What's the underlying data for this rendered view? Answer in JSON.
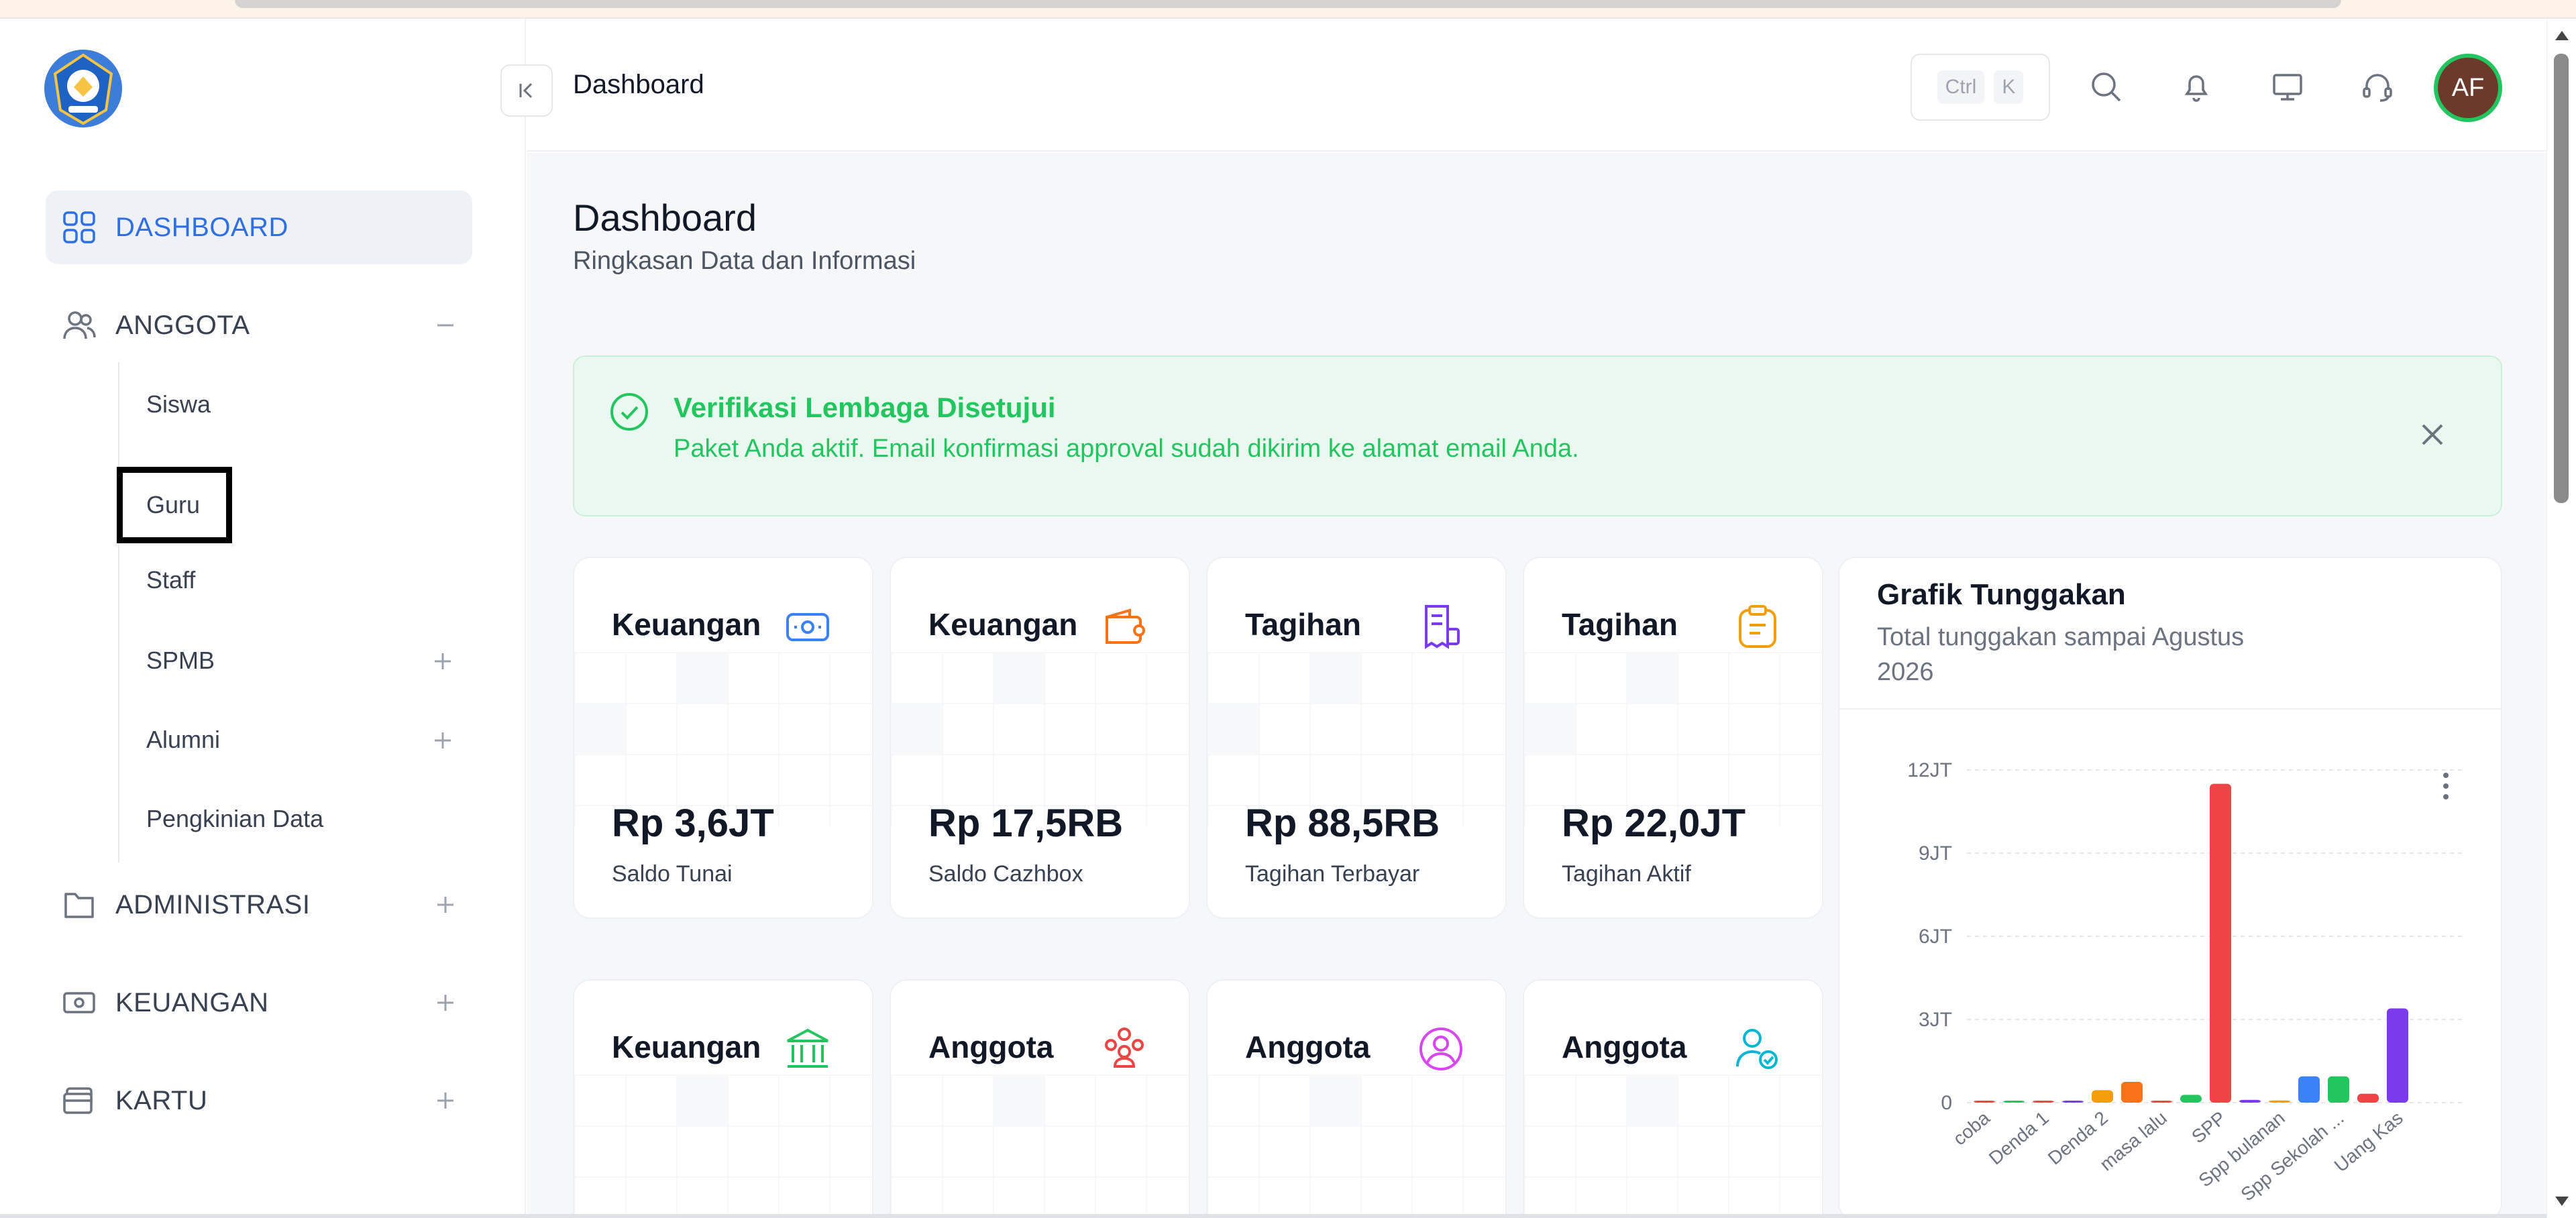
{
  "app": {
    "header_title": "Dashboard",
    "shortcut_keys": [
      "Ctrl",
      "K"
    ],
    "avatar_initials": "AF"
  },
  "sidebar": {
    "items": [
      {
        "label": "DASHBOARD",
        "icon": "grid-icon",
        "active": true
      },
      {
        "label": "ANGGOTA",
        "icon": "users-icon",
        "expanded": true
      },
      {
        "label": "ADMINISTRASI",
        "icon": "folder-icon"
      },
      {
        "label": "KEUANGAN",
        "icon": "money-icon"
      },
      {
        "label": "KARTU",
        "icon": "card-icon"
      }
    ],
    "anggota_sub": [
      "Siswa",
      "Guru",
      "Staff",
      "SPMB",
      "Alumni",
      "Pengkinian Data"
    ]
  },
  "page": {
    "title": "Dashboard",
    "subtitle": "Ringkasan Data dan Informasi"
  },
  "alert": {
    "title": "Verifikasi Lembaga Disetujui",
    "message": "Paket Anda aktif. Email konfirmasi approval sudah dikirim ke alamat email Anda."
  },
  "cards": [
    {
      "title": "Keuangan",
      "value": "Rp 3,6JT",
      "label": "Saldo Tunai",
      "icon": "wallet-icon",
      "color": "#3b82f6"
    },
    {
      "title": "Keuangan",
      "value": "Rp 17,5RB",
      "label": "Saldo Cazhbox",
      "icon": "wallet-card-icon",
      "color": "#f97316"
    },
    {
      "title": "Tagihan",
      "value": "Rp 88,5RB",
      "label": "Tagihan Terbayar",
      "icon": "receipt-icon",
      "color": "#7c3aed"
    },
    {
      "title": "Tagihan",
      "value": "Rp 22,0JT",
      "label": "Tagihan Aktif",
      "icon": "clipboard-icon",
      "color": "#f59e0b"
    },
    {
      "title": "Keuangan",
      "icon": "bank-icon",
      "color": "#22c55e"
    },
    {
      "title": "Anggota",
      "icon": "group-icon",
      "color": "#ef4444"
    },
    {
      "title": "Anggota",
      "icon": "user-circle-icon",
      "color": "#d946ef"
    },
    {
      "title": "Anggota",
      "icon": "user-check-icon",
      "color": "#06b6d4"
    }
  ],
  "chart": {
    "title": "Grafik Tunggakan",
    "subtitle": "Total tunggakan sampai Agustus 2026"
  },
  "chart_data": {
    "type": "bar",
    "categories": [
      "coba",
      "",
      "Denda 1",
      "",
      "Denda 2",
      "",
      "masa lalu",
      "",
      "SPP",
      "",
      "Spp bulanan",
      "",
      "Spp Sekolah ...",
      "",
      "Uang Kas"
    ],
    "values": [
      20000,
      20000,
      50000,
      60000,
      450000,
      750000,
      30000,
      280000,
      11500000,
      100000,
      80000,
      950000,
      950000,
      320000,
      3400000
    ],
    "colors": [
      "#ef4444",
      "#22c55e",
      "#ef4444",
      "#7c3aed",
      "#f59e0b",
      "#f97316",
      "#ef4444",
      "#22c55e",
      "#ef4444",
      "#7c3aed",
      "#f59e0b",
      "#3b82f6",
      "#22c55e",
      "#ef4444",
      "#7c3aed"
    ],
    "yticks": [
      "0",
      "3JT",
      "6JT",
      "9JT",
      "12JT"
    ],
    "ylim": [
      0,
      12000000
    ],
    "grid": true
  }
}
